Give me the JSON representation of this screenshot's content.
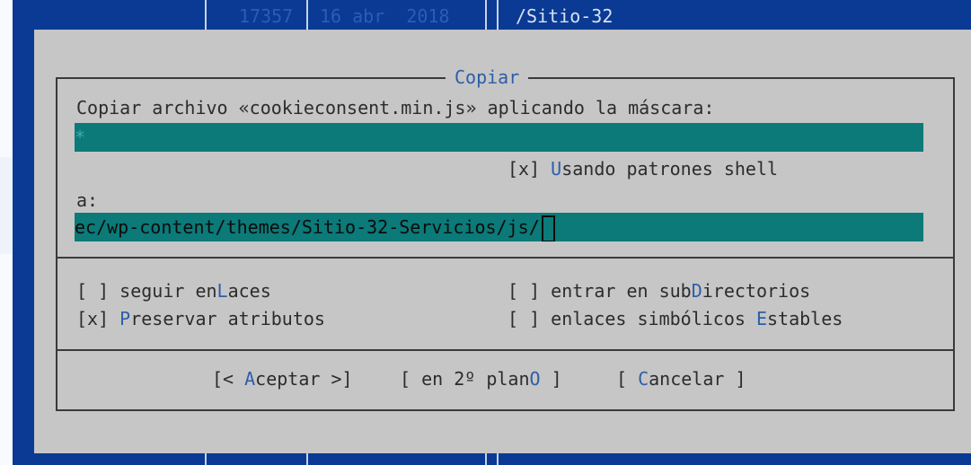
{
  "background_panel": {
    "row_id": "17357",
    "row_date": "16 abr  2018",
    "row_path": "/Sitio-32"
  },
  "dialog": {
    "title": "Copiar",
    "source_label": "Copiar archivo «cookieconsent.min.js» aplicando la máscara:",
    "mask_value": "*",
    "shell_patterns": {
      "box": "[x] ",
      "hot": "U",
      "rest": "sando patrones shell"
    },
    "dest_label": "a:",
    "dest_value": "ec/wp-content/themes/Sitio-32-Servicios/js/",
    "options": {
      "follow_links": {
        "box": "[ ] ",
        "pre": "seguir en",
        "hot": "L",
        "post": "aces"
      },
      "preserve_attrs": {
        "box": "[x] ",
        "pre": "",
        "hot": "P",
        "post": "reservar atributos"
      },
      "dive_subdirs": {
        "box": "[ ] ",
        "pre": "entrar en sub",
        "hot": "D",
        "post": "irectorios"
      },
      "stable_symlinks": {
        "box": "[ ] ",
        "pre": "enlaces simbólicos ",
        "hot": "E",
        "post": "stables"
      }
    },
    "buttons": {
      "ok": {
        "pre": "[< ",
        "hot": "A",
        "post": "ceptar >]"
      },
      "background": {
        "pre": "[ en 2º plan",
        "hot": "O",
        "post": " ]"
      },
      "cancel": {
        "pre": "[ ",
        "hot": "C",
        "post": "ancelar ]"
      }
    }
  },
  "colors": {
    "panel_blue": "#0a3a94",
    "dialog_gray": "#c6c6c6",
    "input_teal": "#0b7a78",
    "hotkey_blue": "#2d5ea8"
  }
}
